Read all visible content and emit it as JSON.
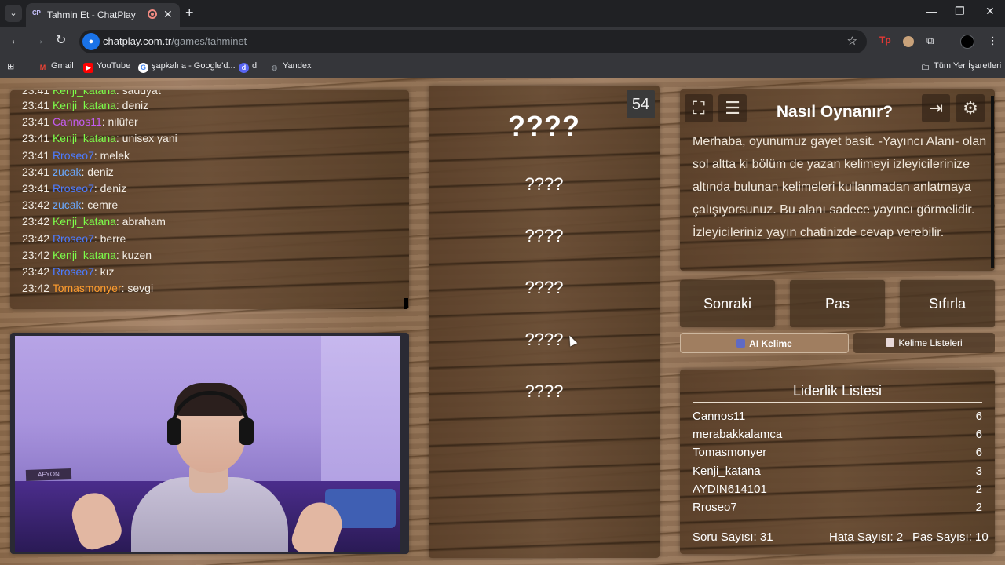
{
  "browser": {
    "tab_title": "Tahmin Et - ChatPlay",
    "tab_favicon": "CP",
    "url_host": "chatplay.com.tr",
    "url_path": "/games/tahminet",
    "bookmarks": [
      {
        "label": "Gmail",
        "icon": "gmail-icon",
        "color": "#ea4335"
      },
      {
        "label": "YouTube",
        "icon": "youtube-icon",
        "color": "#ff0000"
      },
      {
        "label": "şapkalı a - Google'd...",
        "icon": "google-icon",
        "color": "#ffffff"
      },
      {
        "label": "d",
        "icon": "discord-icon",
        "color": "#5865f2"
      },
      {
        "label": "Yandex",
        "icon": "yandex-icon",
        "color": "#9aa0a6"
      }
    ],
    "all_bookmarks": "Tüm Yer İşaretleri"
  },
  "chat": {
    "partial_line": {
      "time": "23:41",
      "user": "Kenji_katana",
      "text": "saddyat"
    },
    "messages": [
      {
        "time": "23:41",
        "user": "Kenji_katana",
        "color": "#7cfc4a",
        "text": "deniz"
      },
      {
        "time": "23:41",
        "user": "Cannos11",
        "color": "#c45cf0",
        "text": "nilüfer"
      },
      {
        "time": "23:41",
        "user": "Kenji_katana",
        "color": "#7cfc4a",
        "text": "unisex yani"
      },
      {
        "time": "23:41",
        "user": "Rroseo7",
        "color": "#4c7bff",
        "text": "melek"
      },
      {
        "time": "23:41",
        "user": "zucak",
        "color": "#6aa9ff",
        "text": "deniz"
      },
      {
        "time": "23:41",
        "user": "Rroseo7",
        "color": "#4c7bff",
        "text": "deniz"
      },
      {
        "time": "23:42",
        "user": "zucak",
        "color": "#6aa9ff",
        "text": "cemre"
      },
      {
        "time": "23:42",
        "user": "Kenji_katana",
        "color": "#7cfc4a",
        "text": "abraham"
      },
      {
        "time": "23:42",
        "user": "Rroseo7",
        "color": "#4c7bff",
        "text": "berre"
      },
      {
        "time": "23:42",
        "user": "Kenji_katana",
        "color": "#7cfc4a",
        "text": "kuzen"
      },
      {
        "time": "23:42",
        "user": "Rroseo7",
        "color": "#4c7bff",
        "text": "kız"
      },
      {
        "time": "23:42",
        "user": "Tomasmonyer",
        "color": "#ff9d2e",
        "text": "sevgi"
      }
    ]
  },
  "webcam": {
    "sign_text": "AFYON"
  },
  "game": {
    "timer": "54",
    "main_word": "????",
    "forbidden_words": [
      "????",
      "????",
      "????",
      "????",
      "????"
    ]
  },
  "howto": {
    "title": "Nasıl Oynanır?",
    "text": "Merhaba, oyunumuz gayet basit. -Yayıncı Alanı- olan sol altta ki bölüm de yazan kelimeyi izleyicilerinize altında bulunan kelimeleri kullanmadan anlatmaya çalışıyorsunuz. Bu alanı sadece yayıncı görmelidir. İzleyicileriniz yayın chatinizde cevap verebilir.",
    "icons": [
      "fullscreen-icon",
      "notes-icon",
      "exit-icon",
      "settings-icon"
    ]
  },
  "actions": {
    "next": "Sonraki",
    "pass": "Pas",
    "reset": "Sıfırla"
  },
  "word_tabs": {
    "ai": "AI Kelime",
    "lists": "Kelime Listeleri"
  },
  "leaderboard": {
    "title": "Liderlik Listesi",
    "rows": [
      {
        "name": "Cannos11",
        "score": "6"
      },
      {
        "name": "merabakkalamca",
        "score": "6"
      },
      {
        "name": "Tomasmonyer",
        "score": "6"
      },
      {
        "name": "Kenji_katana",
        "score": "3"
      },
      {
        "name": "AYDIN614101",
        "score": "2"
      },
      {
        "name": "Rroseo7",
        "score": "2"
      }
    ],
    "question_count": "Soru Sayısı: 31",
    "error_count": "Hata Sayısı: 2",
    "pass_count": "Pas Sayısı: 10"
  }
}
